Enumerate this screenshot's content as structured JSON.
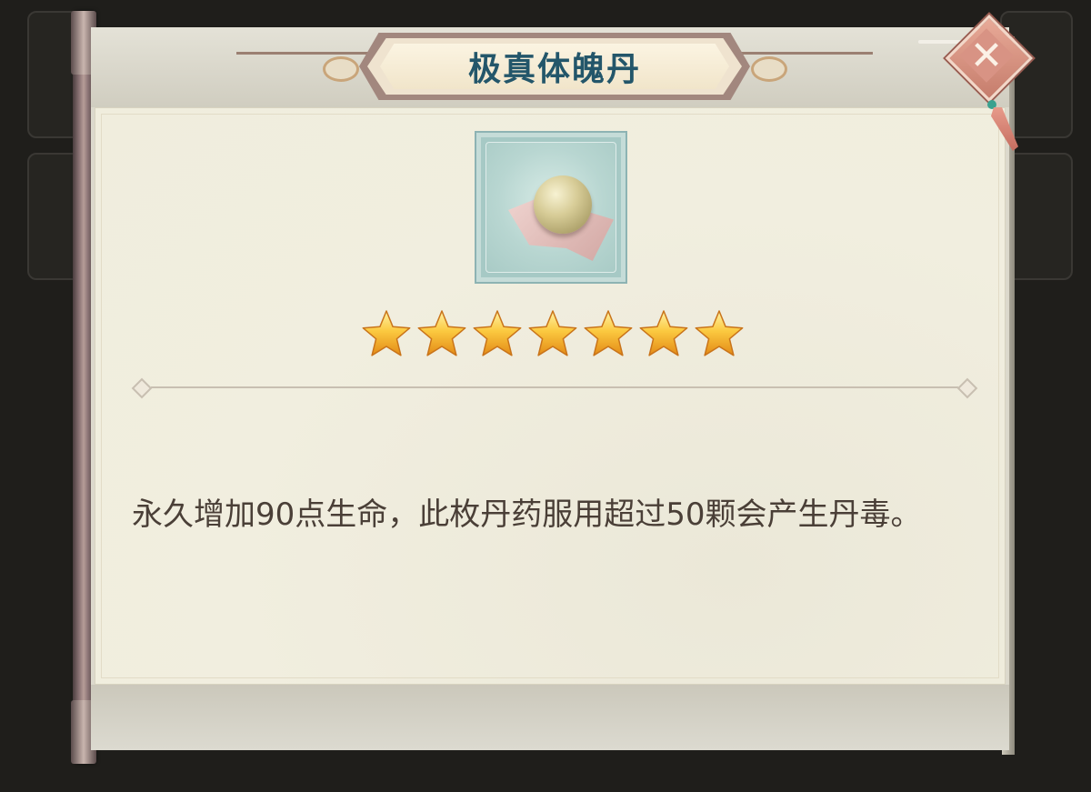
{
  "item": {
    "title": "极真体魄丹",
    "star_count": 7,
    "description": "永久增加90点生命，此枚丹药服用超过50颗会产生丹毒。"
  },
  "colors": {
    "title_text": "#23566a",
    "description_text": "#4a3f37",
    "star": "#f6b12a",
    "close_button": "#d48c7c"
  },
  "icons": {
    "close": "close-icon",
    "item": "pill-icon",
    "star": "star-icon"
  }
}
